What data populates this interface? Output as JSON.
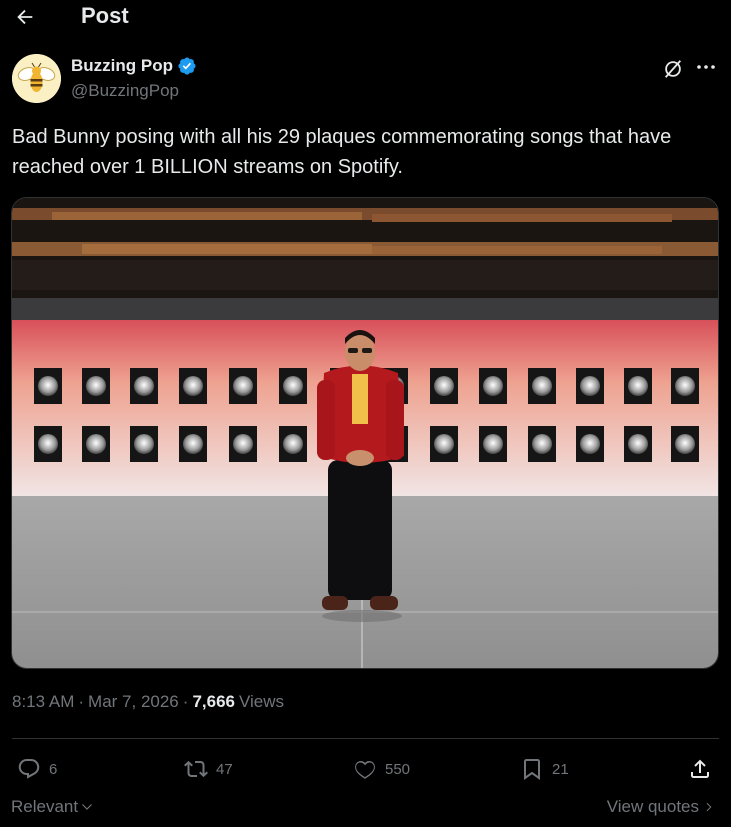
{
  "header": {
    "title": "Post"
  },
  "author": {
    "name": "Buzzing Pop",
    "handle": "@BuzzingPop"
  },
  "post": {
    "text": "Bad Bunny posing with all his 29 plaques commemorating songs that have reached over 1 BILLION streams on Spotify.",
    "time": "8:13 AM",
    "separator1": "·",
    "date": "Mar 7, 2026",
    "separator2": "·",
    "views_count": "7,666",
    "views_label": "Views"
  },
  "actions": {
    "replies": "6",
    "reposts": "47",
    "likes": "550",
    "bookmarks": "21"
  },
  "footer": {
    "sort_label": "Relevant",
    "view_quotes": "View quotes"
  },
  "icons": {
    "back": "back-arrow-icon",
    "verified": "verified-badge-icon",
    "grok": "grok-icon",
    "more": "more-icon",
    "reply": "reply-icon",
    "repost": "repost-icon",
    "like": "heart-icon",
    "bookmark": "bookmark-icon",
    "share": "share-icon"
  },
  "colors": {
    "background": "#000000",
    "text": "#e7e9ea",
    "muted": "#71767b",
    "verified": "#1d9bf0",
    "divider": "#2f3336"
  }
}
